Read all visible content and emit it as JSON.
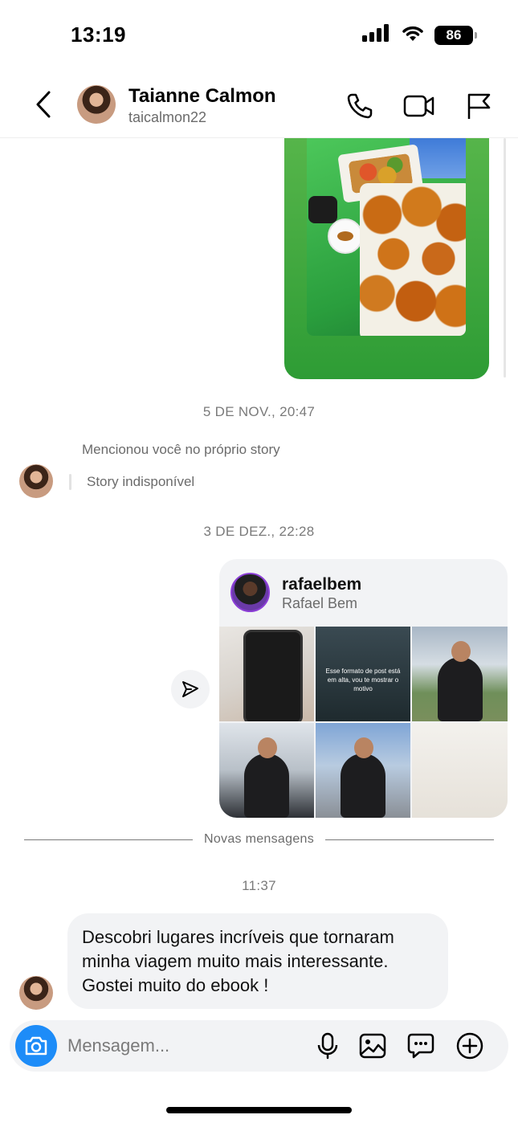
{
  "status_bar": {
    "time": "13:19",
    "battery": "86",
    "icons": [
      "signal-icon",
      "wifi-icon",
      "battery-icon"
    ]
  },
  "header": {
    "name": "Taianne Calmon",
    "handle": "taicalmon22",
    "icons": [
      "back-chevron-icon",
      "phone-icon",
      "video-call-icon",
      "flag-icon"
    ]
  },
  "chat": {
    "timestamp_1": "5 DE NOV., 20:47",
    "mention_text": "Mencionou você no próprio story",
    "story_unavailable": "Story indisponível",
    "timestamp_2": "3 DE DEZ., 22:28",
    "profile_card": {
      "username": "rafaelbem",
      "full_name": "Rafael Bem",
      "tile_caption": "Esse formato de post está em alta, vou te mostrar o motivo"
    },
    "new_messages_label": "Novas mensagens",
    "timestamp_3": "11:37",
    "message_text": "Descobri lugares incríveis que tornaram minha viagem muito mais interessante. Gostei muito do ebook !"
  },
  "composer": {
    "placeholder": "Mensagem...",
    "icons": [
      "camera-icon",
      "microphone-icon",
      "gallery-icon",
      "sticker-icon",
      "plus-icon"
    ]
  },
  "colors": {
    "accent_blue": "#1d8cf8",
    "bubble_grey": "#f2f3f5",
    "story_green": "#2e9c35"
  }
}
